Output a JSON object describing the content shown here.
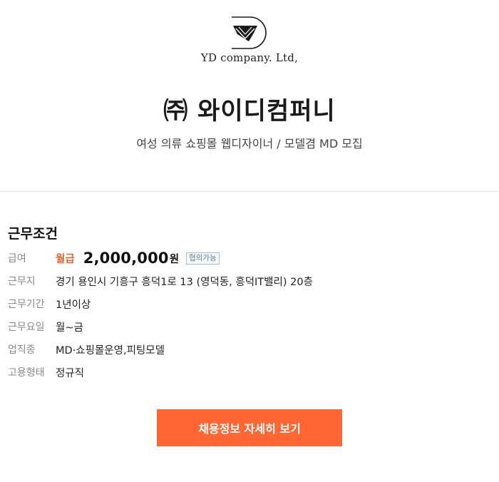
{
  "header": {
    "logo_icon": "yd-logo-icon",
    "logo_text": "YD company. Ltd,",
    "company_name": "㈜ 와이디컴퍼니",
    "subtitle": "여성 의류 쇼핑몰 웹디자이너 / 모델겸 MD 모집"
  },
  "conditions": {
    "title": "근무조건",
    "salary": {
      "label": "급여",
      "type": "월급",
      "amount": "2,000,000",
      "unit": "원",
      "badge": "협의가능"
    },
    "location": {
      "label": "근무지",
      "value": "경기 용인시 기흥구 흥덕1로 13 (영덕동, 흥덕IT밸리) 20층"
    },
    "period": {
      "label": "근무기간",
      "value": "1년이상"
    },
    "days": {
      "label": "근무요일",
      "value": "월~금"
    },
    "industry": {
      "label": "업직종",
      "value": "MD·쇼핑몰운영,피팅모델"
    },
    "employment": {
      "label": "고용형태",
      "value": "정규직"
    }
  },
  "cta": {
    "label": "채용정보 자세히 보기"
  },
  "colors": {
    "accent": "#ff6633",
    "salary_type": "#e0662f",
    "badge_border": "#a9bfd0"
  }
}
